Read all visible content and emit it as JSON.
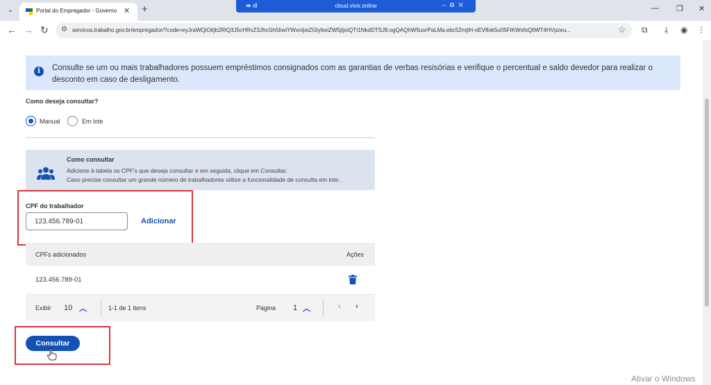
{
  "browser": {
    "tab_title": "Portal do Empregador - Governo",
    "tab_close": "✕",
    "new_tab": "+",
    "remote_title": "cloud.vivix.online",
    "url": "servicos.trabalho.gov.br/empregador/?code=eyJraWQiOiIjb2RlQ3J5cHRvZ3JhcGh5IiwiYWxnIjoiZGlyIiwiZW5jIjoiQTI1NkdDTSJ9.ogQAQhW5uorPaLMa.ebc52mjtH-oEV8ok5u05FIKWxfsQlIWT4HVpzeu..."
  },
  "info": {
    "text": "Consulte se um ou mais trabalhadores possuem empréstimos consignados com as garantias de verbas resisórias e verifique o percentual e saldo devedor para realizar o desconto em caso de desligamento."
  },
  "consult_mode": {
    "label": "Como deseja consultar?",
    "options": [
      {
        "label": "Manual",
        "checked": true
      },
      {
        "label": "Em lote",
        "checked": false
      }
    ]
  },
  "how_to": {
    "title": "Como consultar",
    "line1": "Adicione à tabela os CPF's que deseja consultar e em seguida, clique em Consultar.",
    "line2": "Caso precise consultar um grande número de trabalhadores utilize a funcionalidade de consulta em lote."
  },
  "cpf_field": {
    "label": "CPF do trabalhador",
    "value": "123.456.789-01",
    "add_label": "Adicionar"
  },
  "table": {
    "col_cpf": "CPFs adicionados",
    "col_actions": "Ações",
    "rows": [
      {
        "cpf": "123.456.789-01"
      }
    ]
  },
  "pagination": {
    "show_label": "Exibir",
    "page_size": "10",
    "range": "1-1 de 1 itens",
    "page_label": "Página",
    "page": "1"
  },
  "submit_label": "Consultar",
  "watermark": "Ativar o Windows",
  "colors": {
    "primary": "#1351b4",
    "highlight": "#d9343a",
    "info_bg": "#dbe8fb"
  }
}
